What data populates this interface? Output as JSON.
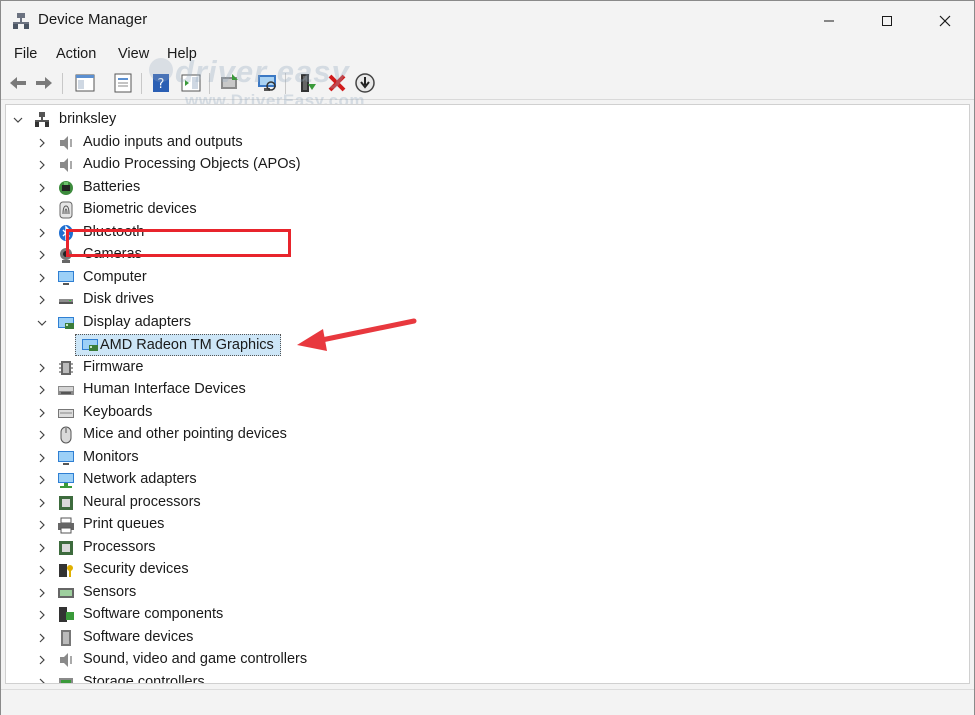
{
  "window": {
    "title": "Device Manager",
    "minimize_icon": "minimize-icon",
    "maximize_icon": "maximize-icon",
    "close_icon": "close-icon"
  },
  "menu": [
    "File",
    "Action",
    "View",
    "Help"
  ],
  "toolbar": {
    "icons": [
      "back-arrow-icon",
      "forward-arrow-icon",
      "show-hide-console-tree-icon",
      "properties-icon",
      "help-icon",
      "action-pane-icon",
      "update-driver-icon",
      "scan-hardware-icon",
      "add-legacy-icon",
      "uninstall-icon",
      "disable-icon"
    ]
  },
  "watermark": {
    "main": "driver easy",
    "sub": "www.DriverEasy.com"
  },
  "tree": {
    "root": "brinksley",
    "categories": [
      {
        "label": "Audio inputs and outputs",
        "icon": "speaker-icon"
      },
      {
        "label": "Audio Processing Objects (APOs)",
        "icon": "speaker-icon"
      },
      {
        "label": "Batteries",
        "icon": "battery-icon"
      },
      {
        "label": "Biometric devices",
        "icon": "fingerprint-icon"
      },
      {
        "label": "Bluetooth",
        "icon": "bluetooth-icon"
      },
      {
        "label": "Cameras",
        "icon": "camera-icon"
      },
      {
        "label": "Computer",
        "icon": "computer-icon"
      },
      {
        "label": "Disk drives",
        "icon": "disk-icon"
      },
      {
        "label": "Display adapters",
        "icon": "display-adapter-icon",
        "expanded": true,
        "children": [
          {
            "label": "AMD Radeon TM Graphics",
            "icon": "display-adapter-icon",
            "selected": true
          }
        ]
      },
      {
        "label": "Firmware",
        "icon": "firmware-icon"
      },
      {
        "label": "Human Interface Devices",
        "icon": "hid-icon"
      },
      {
        "label": "Keyboards",
        "icon": "keyboard-icon"
      },
      {
        "label": "Mice and other pointing devices",
        "icon": "mouse-icon"
      },
      {
        "label": "Monitors",
        "icon": "monitor-icon"
      },
      {
        "label": "Network adapters",
        "icon": "network-icon"
      },
      {
        "label": "Neural processors",
        "icon": "chip-icon"
      },
      {
        "label": "Print queues",
        "icon": "printer-icon"
      },
      {
        "label": "Processors",
        "icon": "chip-icon"
      },
      {
        "label": "Security devices",
        "icon": "security-icon"
      },
      {
        "label": "Sensors",
        "icon": "sensor-icon"
      },
      {
        "label": "Software components",
        "icon": "software-component-icon"
      },
      {
        "label": "Software devices",
        "icon": "software-device-icon"
      },
      {
        "label": "Sound, video and game controllers",
        "icon": "speaker-icon"
      },
      {
        "label": "Storage controllers",
        "icon": "storage-icon"
      }
    ]
  },
  "colors": {
    "highlight_border": "#e8242c",
    "arrow": "#e8383e",
    "selection_bg": "#cde6f7"
  }
}
